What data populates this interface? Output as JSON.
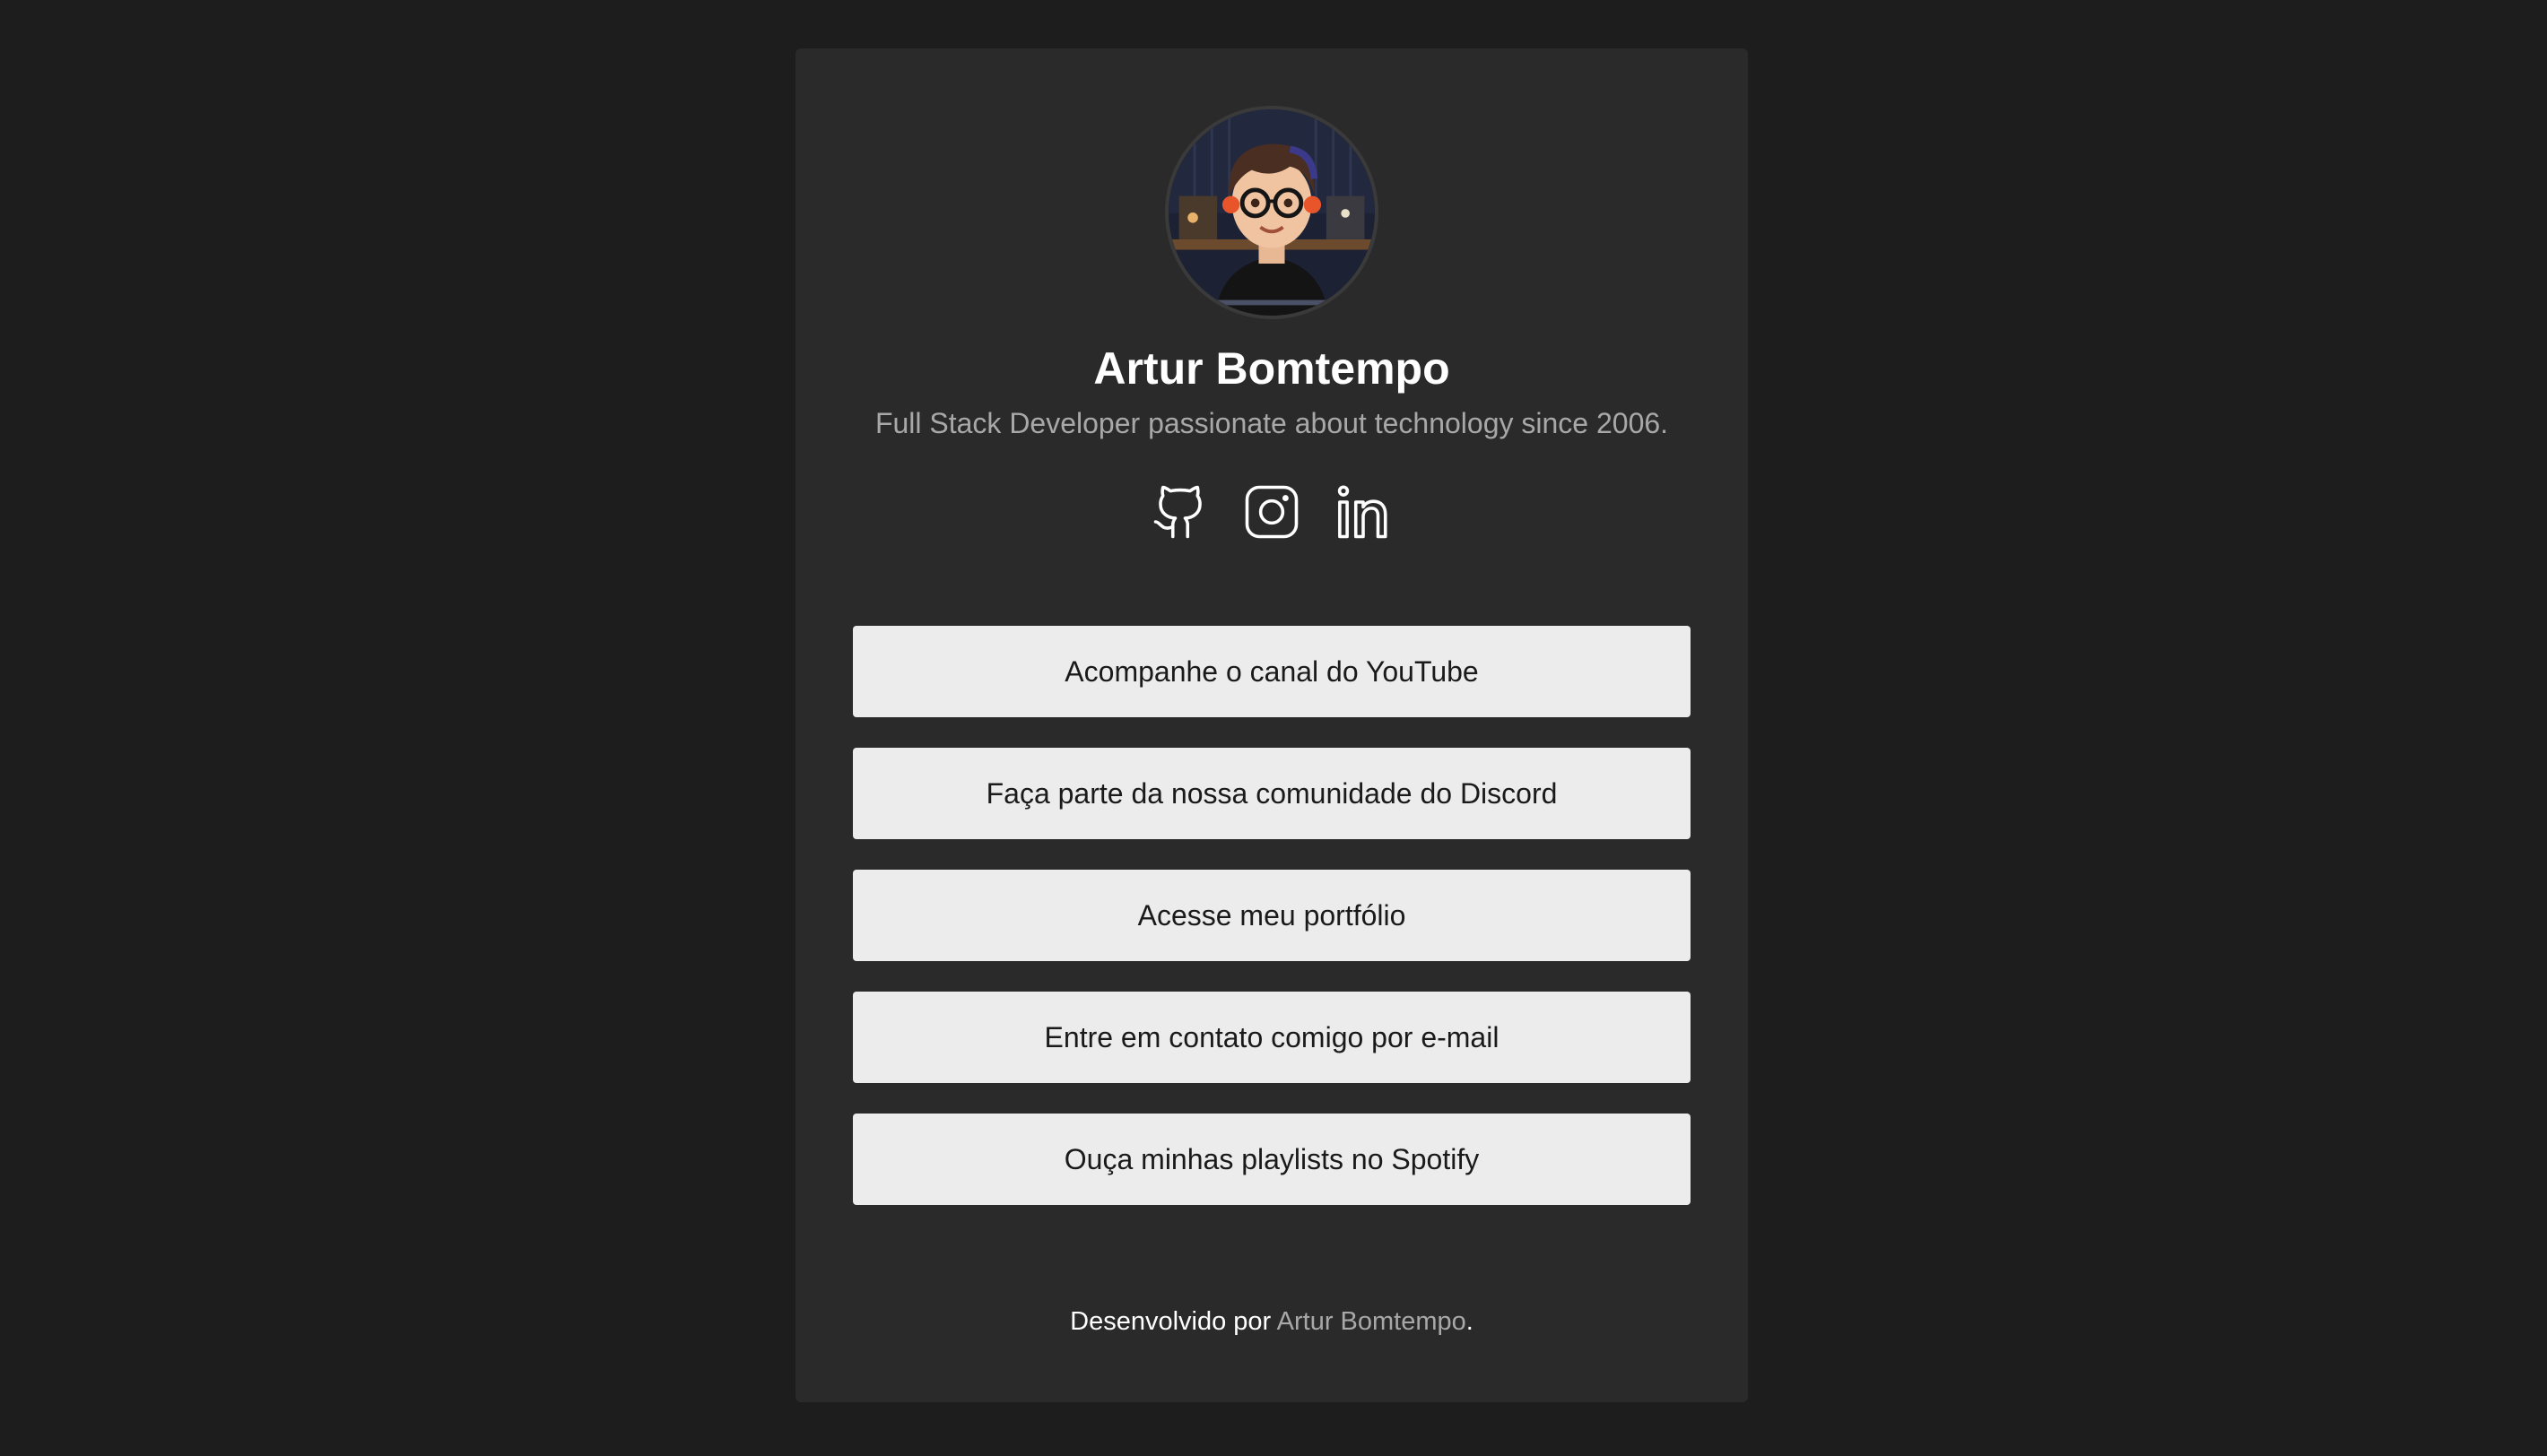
{
  "profile": {
    "name": "Artur Bomtempo",
    "bio": "Full Stack Developer passionate about technology since 2006."
  },
  "socials": [
    {
      "icon": "github-icon"
    },
    {
      "icon": "instagram-icon"
    },
    {
      "icon": "linkedin-icon"
    }
  ],
  "links": [
    {
      "label": "Acompanhe o canal do YouTube"
    },
    {
      "label": "Faça parte da nossa comunidade do Discord"
    },
    {
      "label": "Acesse meu portfólio"
    },
    {
      "label": "Entre em contato comigo por e-mail"
    },
    {
      "label": "Ouça minhas playlists no Spotify"
    }
  ],
  "footer": {
    "prefix": "Desenvolvido por ",
    "author": "Artur Bomtempo",
    "suffix": "."
  },
  "colors": {
    "page_bg": "#1d1d1d",
    "card_bg": "#2a2a2a",
    "button_bg": "#ececec",
    "muted_text": "#a8a8a8"
  }
}
